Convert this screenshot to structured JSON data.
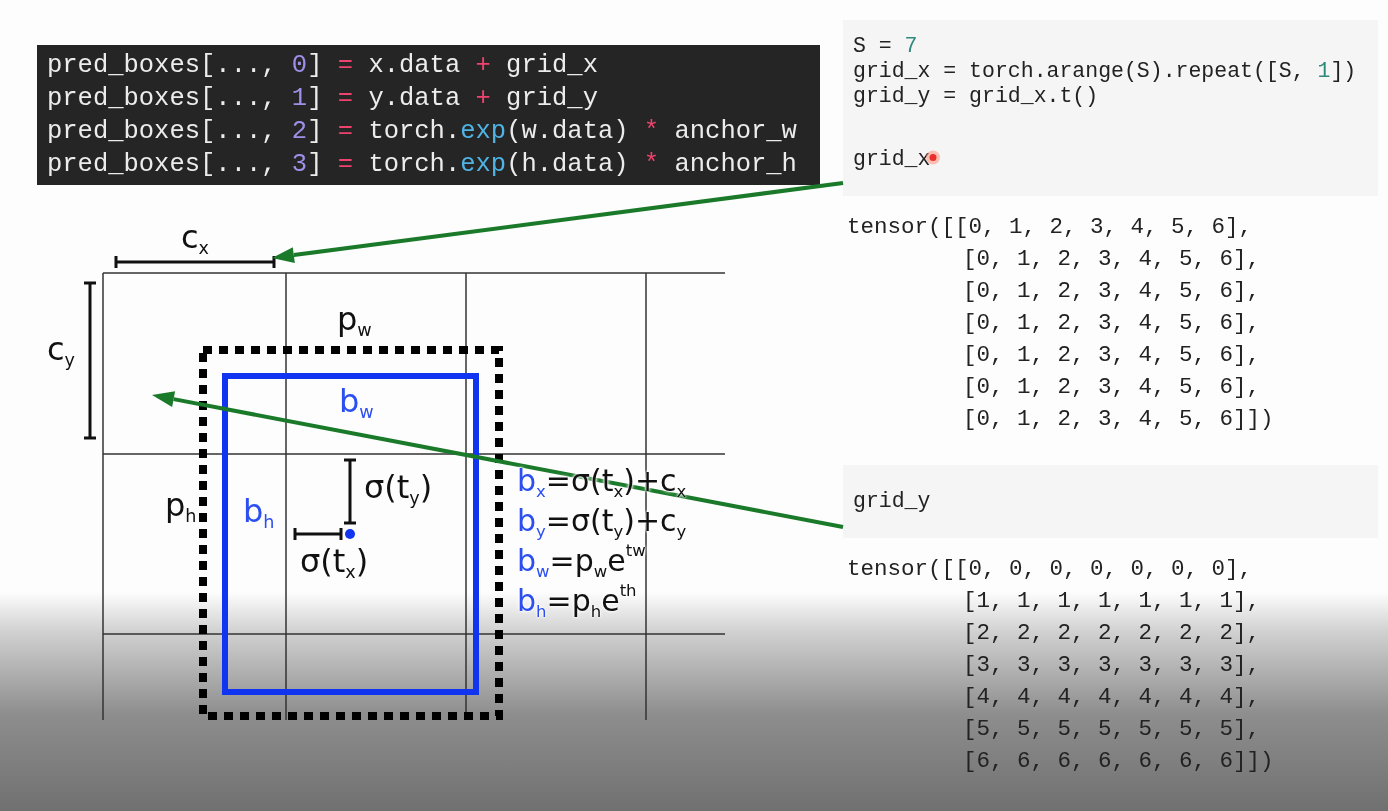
{
  "code_block": {
    "lines": [
      [
        {
          "kind": "plain",
          "text": "pred_boxes[..., "
        },
        {
          "kind": "number",
          "text": "0"
        },
        {
          "kind": "plain",
          "text": "] "
        },
        {
          "kind": "operator",
          "text": "="
        },
        {
          "kind": "plain",
          "text": " x.data "
        },
        {
          "kind": "operator",
          "text": "+"
        },
        {
          "kind": "plain",
          "text": " grid_x"
        }
      ],
      [
        {
          "kind": "plain",
          "text": "pred_boxes[..., "
        },
        {
          "kind": "number",
          "text": "1"
        },
        {
          "kind": "plain",
          "text": "] "
        },
        {
          "kind": "operator",
          "text": "="
        },
        {
          "kind": "plain",
          "text": " y.data "
        },
        {
          "kind": "operator",
          "text": "+"
        },
        {
          "kind": "plain",
          "text": " grid_y"
        }
      ],
      [
        {
          "kind": "plain",
          "text": "pred_boxes[..., "
        },
        {
          "kind": "number",
          "text": "2"
        },
        {
          "kind": "plain",
          "text": "] "
        },
        {
          "kind": "operator",
          "text": "="
        },
        {
          "kind": "plain",
          "text": " torch."
        },
        {
          "kind": "builtin",
          "text": "exp"
        },
        {
          "kind": "plain",
          "text": "(w.data) "
        },
        {
          "kind": "operator",
          "text": "*"
        },
        {
          "kind": "plain",
          "text": " anchor_w"
        }
      ],
      [
        {
          "kind": "plain",
          "text": "pred_boxes[..., "
        },
        {
          "kind": "number",
          "text": "3"
        },
        {
          "kind": "plain",
          "text": "] "
        },
        {
          "kind": "operator",
          "text": "="
        },
        {
          "kind": "plain",
          "text": " torch."
        },
        {
          "kind": "builtin",
          "text": "exp"
        },
        {
          "kind": "plain",
          "text": "(h.data) "
        },
        {
          "kind": "operator",
          "text": "*"
        },
        {
          "kind": "plain",
          "text": " anchor_h"
        }
      ]
    ]
  },
  "diagram": {
    "labels": [
      {
        "kind": "grid",
        "text": "c$_{x}$"
      },
      {
        "kind": "grid",
        "text": "c$_{y}$"
      },
      {
        "kind": "grid",
        "text": "p$_{w}$"
      },
      {
        "kind": "box",
        "text": "b$_{w}$"
      },
      {
        "kind": "grid",
        "text": "p$_{h}$"
      },
      {
        "kind": "box",
        "text": "b$_{h}$"
      },
      {
        "kind": "grid",
        "text": "σ(t$_{y}$)"
      },
      {
        "kind": "grid",
        "text": "σ(t$_{x}$)"
      }
    ],
    "formulas": [
      {
        "variable": "b$_{x}$",
        "expression": "=σ(t$_{x}$)+c$_{x}$"
      },
      {
        "variable": "b$_{y}$",
        "expression": "=σ(t$_{y}$)+c$_{y}$"
      },
      {
        "variable": "b$_{w}$",
        "expression": "=p$_{w}$e$^{tw}$"
      },
      {
        "variable": "b$_{h}$",
        "expression": "=p$_{h}$e$^{th}$"
      }
    ]
  },
  "notebook": {
    "cells": [
      {
        "input": [
          [
            {
              "kind": "plain",
              "text": "S = "
            },
            {
              "kind": "number",
              "text": "7"
            }
          ],
          [
            {
              "kind": "plain",
              "text": "grid_x = torch.arange(S).repeat([S, "
            },
            {
              "kind": "number",
              "text": "1"
            },
            {
              "kind": "plain",
              "text": "])"
            }
          ],
          [
            {
              "kind": "plain",
              "text": "grid_y = grid_x.t()"
            }
          ]
        ]
      },
      {
        "input": [
          [
            {
              "kind": "plain",
              "text": "grid_x"
            }
          ]
        ],
        "cursor": true,
        "output": [
          "tensor([[0, 1, 2, 3, 4, 5, 6],",
          "[0, 1, 2, 3, 4, 5, 6],",
          "[0, 1, 2, 3, 4, 5, 6],",
          "[0, 1, 2, 3, 4, 5, 6],",
          "[0, 1, 2, 3, 4, 5, 6],",
          "[0, 1, 2, 3, 4, 5, 6],",
          "[0, 1, 2, 3, 4, 5, 6]])"
        ]
      },
      {
        "input": [
          [
            {
              "kind": "plain",
              "text": "grid_y"
            }
          ]
        ],
        "output": [
          "tensor([[0, 0, 0, 0, 0, 0, 0],",
          "[1, 1, 1, 1, 1, 1, 1],",
          "[2, 2, 2, 2, 2, 2, 2],",
          "[3, 3, 3, 3, 3, 3, 3],",
          "[4, 4, 4, 4, 4, 4, 4],",
          "[5, 5, 5, 5, 5, 5, 5],",
          "[6, 6, 6, 6, 6, 6, 6]])"
        ]
      }
    ]
  }
}
